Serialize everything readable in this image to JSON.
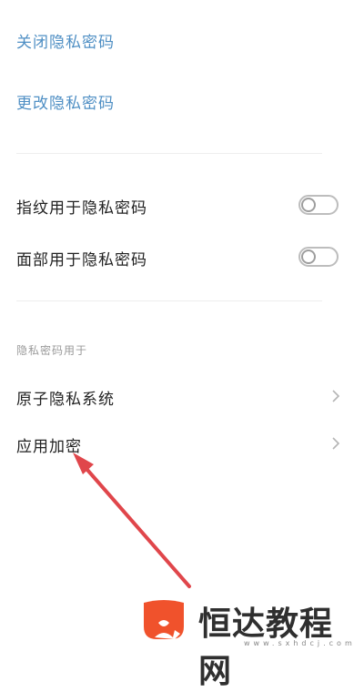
{
  "links": {
    "close_private_password": "关闭隐私密码",
    "change_private_password": "更改隐私密码"
  },
  "biometrics": {
    "fingerprint_label": "指纹用于隐私密码",
    "fingerprint_enabled": false,
    "face_label": "面部用于隐私密码",
    "face_enabled": false
  },
  "usage_section": {
    "header": "隐私密码用于",
    "items": [
      {
        "label": "原子隐私系统",
        "icon": "chevron-right-icon"
      },
      {
        "label": "应用加密",
        "icon": "chevron-right-icon"
      }
    ]
  },
  "watermark": {
    "brand": "恒达教程网",
    "url": "www.sxhdcj.com"
  },
  "colors": {
    "link": "#4f8fc4",
    "annotation_arrow": "#e0464b",
    "watermark_logo": "#f0522c"
  }
}
